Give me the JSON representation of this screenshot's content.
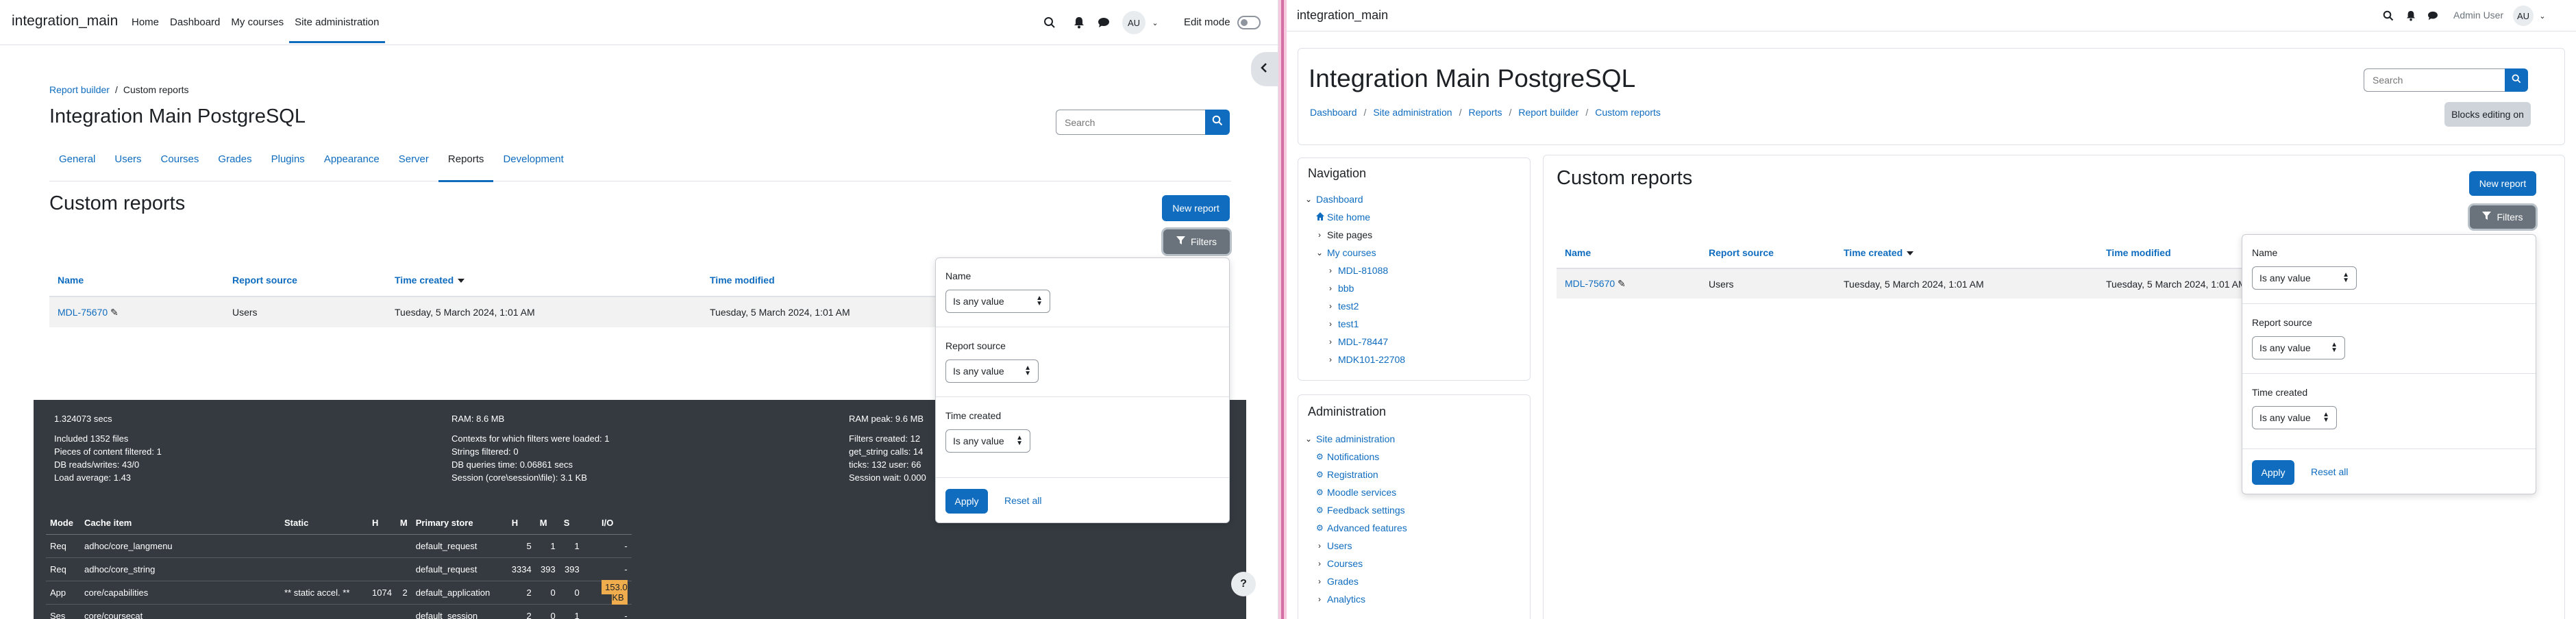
{
  "left": {
    "brand": "integration_main",
    "nav": [
      "Home",
      "Dashboard",
      "My courses",
      "Site administration"
    ],
    "avatar": "AU",
    "edit_mode": "Edit mode",
    "breadcrumb": [
      "Report builder",
      "Custom reports"
    ],
    "page_title": "Integration Main PostgreSQL",
    "search_placeholder": "Search",
    "tabs": [
      "General",
      "Users",
      "Courses",
      "Grades",
      "Plugins",
      "Appearance",
      "Server",
      "Reports",
      "Development"
    ],
    "section_title": "Custom reports",
    "new_report": "New report",
    "filters": "Filters",
    "table": {
      "headers": [
        "Name",
        "Report source",
        "Time created",
        "Time modified"
      ],
      "row": [
        "MDL-75670",
        "Users",
        "Tuesday, 5 March 2024, 1:01 AM",
        "Tuesday, 5 March 2024, 1:01 AM"
      ]
    },
    "filter_panel": {
      "fields": [
        {
          "label": "Name",
          "value": "Is any value"
        },
        {
          "label": "Report source",
          "value": "Is any value"
        },
        {
          "label": "Time created",
          "value": "Is any value"
        }
      ],
      "apply": "Apply",
      "reset": "Reset all"
    },
    "perf": {
      "col1": [
        "1.324073 secs",
        "",
        "Included 1352 files",
        "Pieces of content filtered: 1",
        "DB reads/writes: 43/0",
        "Load average: 1.43"
      ],
      "col2": [
        "RAM: 8.6 MB",
        "",
        "Contexts for which filters were loaded: 1",
        "Strings filtered: 0",
        "DB queries time: 0.06861 secs",
        "Session (core\\session\\file): 3.1 KB"
      ],
      "col3": [
        "RAM peak: 9.6 MB",
        "",
        "Filters created: 12",
        "get_string calls: 14",
        "ticks: 132 user: 66",
        "Session wait: 0.000"
      ],
      "cache_headers": [
        "Mode",
        "Cache item",
        "Static",
        "H",
        "M",
        "Primary store",
        "H",
        "M",
        "S",
        "I/O"
      ],
      "cache_rows": [
        [
          "Req",
          "adhoc/core_langmenu",
          "",
          "",
          "",
          "default_request",
          "5",
          "1",
          "1",
          "-"
        ],
        [
          "Req",
          "adhoc/core_string",
          "",
          "",
          "",
          "default_request",
          "3334",
          "393",
          "393",
          "-"
        ],
        [
          "App",
          "core/capabilities",
          "** static accel. **",
          "1074",
          "2",
          "default_application",
          "2",
          "0",
          "0",
          "153.0 KB"
        ],
        [
          "Ses",
          "core/coursecat",
          "",
          "",
          "",
          "default_session",
          "2",
          "0",
          "1",
          "-"
        ]
      ]
    },
    "help": "?"
  },
  "right": {
    "brand": "integration_main",
    "user_name": "Admin User",
    "avatar": "AU",
    "page_title": "Integration Main PostgreSQL",
    "breadcrumb": [
      "Dashboard",
      "Site administration",
      "Reports",
      "Report builder",
      "Custom reports"
    ],
    "search_placeholder": "Search",
    "blocks_editing": "Blocks editing on",
    "navigation": {
      "title": "Navigation",
      "items": [
        "Dashboard",
        "Site home",
        "Site pages",
        "My courses",
        "MDL-81088",
        "bbb",
        "test2",
        "test1",
        "MDL-78447",
        "MDK101-22708"
      ]
    },
    "administration": {
      "title": "Administration",
      "items": [
        "Site administration",
        "Notifications",
        "Registration",
        "Moodle services",
        "Feedback settings",
        "Advanced features",
        "Users",
        "Courses",
        "Grades",
        "Analytics"
      ]
    },
    "section_title": "Custom reports",
    "new_report": "New report",
    "filters": "Filters",
    "table": {
      "headers": [
        "Name",
        "Report source",
        "Time created",
        "Time modified"
      ],
      "row": [
        "MDL-75670",
        "Users",
        "Tuesday, 5 March 2024, 1:01 AM",
        "Tuesday, 5 March 2024, 1:01 AM"
      ]
    },
    "filter_panel": {
      "fields": [
        {
          "label": "Name",
          "value": "Is any value"
        },
        {
          "label": "Report source",
          "value": "Is any value"
        },
        {
          "label": "Time created",
          "value": "Is any value"
        }
      ],
      "apply": "Apply",
      "reset": "Reset all"
    }
  },
  "colors": {
    "primary": "#0f6cbf",
    "filters_bg": "#6a737b",
    "footer_bg": "#343a40",
    "io_badge": "#f0ad4e",
    "divider": "#d36fa4"
  }
}
